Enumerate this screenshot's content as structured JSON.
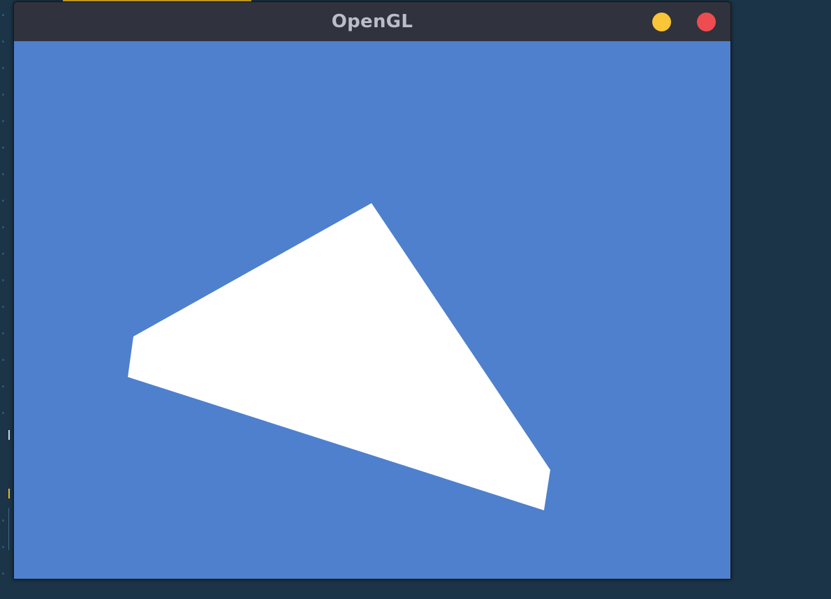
{
  "window": {
    "title": "OpenGL",
    "buttons": {
      "minimize": {
        "icon": "minimize-icon",
        "color": "#fac536"
      },
      "close": {
        "icon": "close-icon",
        "color": "#ee4c50"
      }
    }
  },
  "viewport": {
    "clear_color": "#4e80cd",
    "shape": {
      "type": "quad",
      "fill": "#ffffff"
    }
  },
  "colors": {
    "desktop_background": "#1b3447",
    "titlebar": "#30333d",
    "title_text": "#b9bec8",
    "editor_accent": "#e8b923"
  }
}
